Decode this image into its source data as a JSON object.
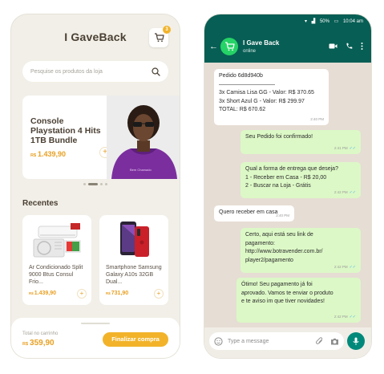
{
  "store": {
    "title": "I GaveBack",
    "cart_count": "3",
    "search_placeholder": "Pesquise os produtos da loja",
    "hero": {
      "title": "Console Playstation 4 Hits 1TB Bundle",
      "currency": "R$",
      "price": "1.439,90",
      "add_label": "+"
    },
    "section_title": "Recentes",
    "products": [
      {
        "name": "Ar Condicionado Split 9000 Btus Consul Frio...",
        "currency": "R$",
        "price": "1.439,90",
        "add_label": "+"
      },
      {
        "name": "Smartphone Samsung Galaxy A10s 32GB Dual...",
        "currency": "R$",
        "price": "731,90",
        "add_label": "+"
      }
    ],
    "footer": {
      "total_label": "Total no carrinho",
      "currency": "R$",
      "total_value": "359,90",
      "checkout_label": "Finalizar compra"
    },
    "colors": {
      "accent": "#f2b32a",
      "price": "#e8a024",
      "background": "#f1efe7"
    }
  },
  "whatsapp": {
    "status_bar": {
      "battery": "50%",
      "time": "10:04 am"
    },
    "contact_name": "I Gave Back",
    "contact_status": "online",
    "messages": [
      {
        "direction": "in",
        "lines": [
          "Pedido 6d8d940b",
          "——————————",
          "3x Camisa Lisa GG - Valor: R$ 370.65",
          "3x Short Azul G - Valor: R$ 299.97",
          "TOTAL: R$ 670.62"
        ],
        "time": "2:40 PM"
      },
      {
        "direction": "out",
        "lines": [
          "Seu Pedido foi confirmado!"
        ],
        "time": "2:41 PM"
      },
      {
        "direction": "out",
        "lines": [
          "Qual a forma de entrega que deseja?",
          "1 - Receber em Casa - R$ 20,00",
          "2 - Buscar na Loja - Grátis"
        ],
        "time": "2:42 PM"
      },
      {
        "direction": "in",
        "lines": [
          "Quero receber em casa"
        ],
        "time": "2:40 PM"
      },
      {
        "direction": "out",
        "lines": [
          "Certo, aqui está seu link de",
          "pagamento:",
          "http://www.botravender.com.br/",
          "player2/pagamento"
        ],
        "time": "2:42 PM"
      },
      {
        "direction": "out",
        "lines": [
          "Ótimo! Seu pagamento já foi",
          "aprovado. Vamos te enviar o produto",
          "e te aviso im que tiver novidades!"
        ],
        "time": "2:42 PM"
      }
    ],
    "input_placeholder": "Type a message",
    "colors": {
      "header": "#075e54",
      "chat_bg": "#e6ddd4",
      "outgoing": "#dcf8c6",
      "incoming": "#ffffff",
      "mic": "#00897b"
    }
  }
}
